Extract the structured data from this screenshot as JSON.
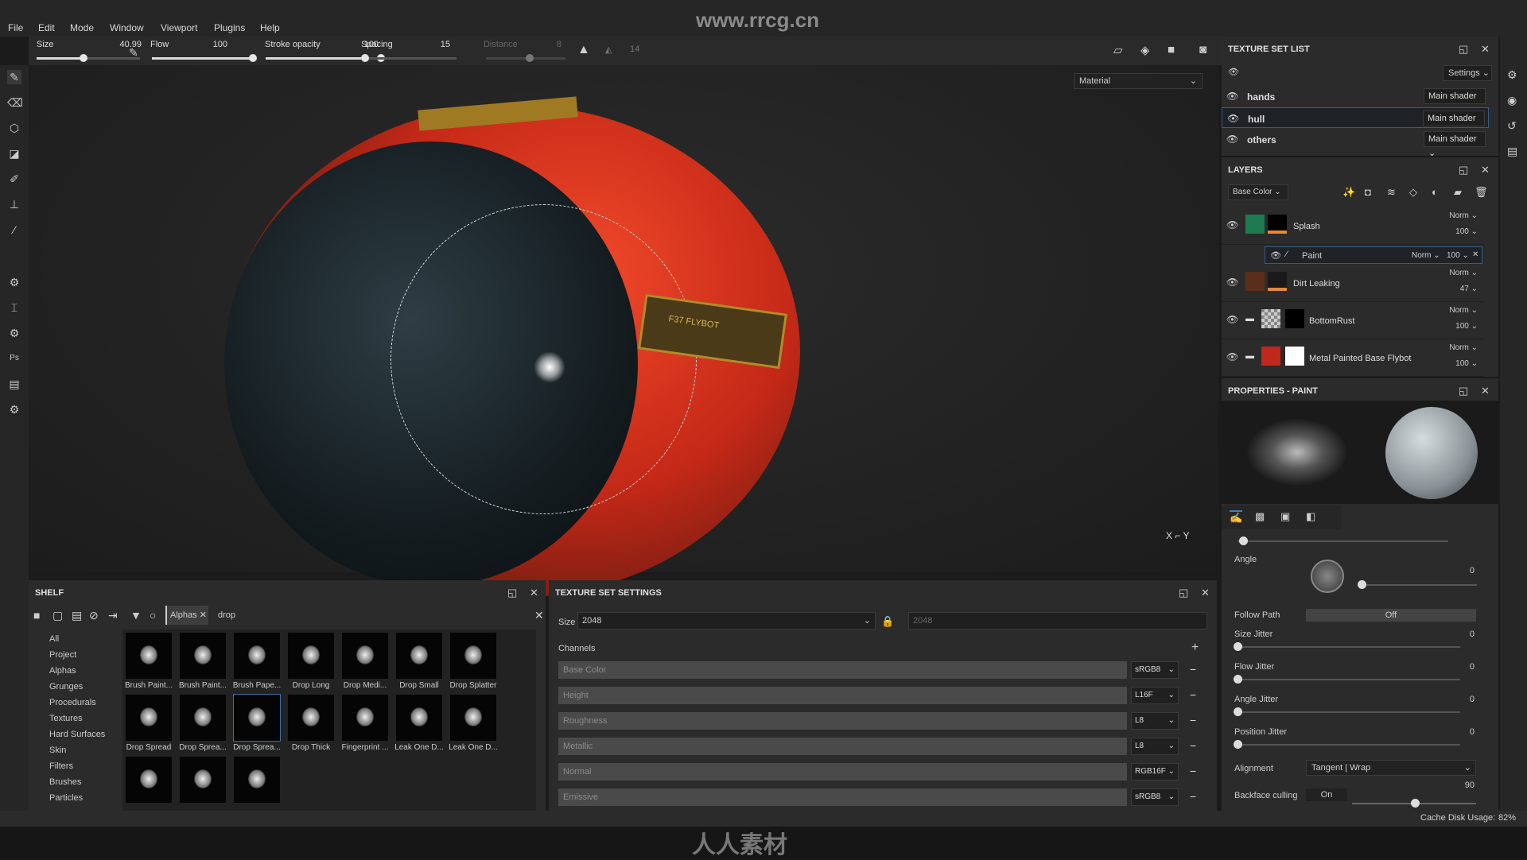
{
  "watermark": "www.rrcg.cn",
  "menu": [
    "File",
    "Edit",
    "Mode",
    "Window",
    "Viewport",
    "Plugins",
    "Help"
  ],
  "toolbar": {
    "size_label": "Size",
    "size_value": "40.99",
    "size_fraction": 0.45,
    "flow_label": "Flow",
    "flow_value": "100",
    "flow_fraction": 1.0,
    "stroke_opacity_label": "Stroke opacity",
    "stroke_opacity_value": "100",
    "stroke_fraction": 1.0,
    "spacing_label": "Spacing",
    "spacing_value": "15",
    "spacing_fraction": 0.05,
    "distance_label": "Distance",
    "distance_value": "8",
    "lazy_value": "14"
  },
  "viewport": {
    "channel_select": "Material",
    "model_label": "F37 FLYBOT"
  },
  "texture_set_list": {
    "title": "TEXTURE SET LIST",
    "settings_label": "Settings",
    "sets": [
      {
        "name": "hands",
        "shader": "Main shader"
      },
      {
        "name": "hull",
        "shader": "Main shader",
        "selected": true
      },
      {
        "name": "others",
        "shader": "Main shader"
      }
    ]
  },
  "layers": {
    "title": "LAYERS",
    "channel": "Base Color",
    "items": [
      {
        "name": "Splash",
        "blend": "Norm",
        "opacity": "100",
        "color": "#1f7a4f"
      },
      {
        "name": "Paint",
        "blend": "Norm",
        "opacity": "100",
        "sub": true
      },
      {
        "name": "Dirt Leaking",
        "blend": "Norm",
        "opacity": "47",
        "color": "#5a2e1a"
      },
      {
        "name": "BottomRust",
        "blend": "Norm",
        "opacity": "100"
      },
      {
        "name": "Metal Painted Base Flybot",
        "blend": "Norm",
        "opacity": "100",
        "color": "#c0281c"
      }
    ]
  },
  "properties": {
    "title": "PROPERTIES - PAINT",
    "angle_label": "Angle",
    "angle_value": "0",
    "follow_path_label": "Follow Path",
    "follow_path_value": "Off",
    "size_jitter_label": "Size Jitter",
    "size_jitter_value": "0",
    "flow_jitter_label": "Flow Jitter",
    "flow_jitter_value": "0",
    "angle_jitter_label": "Angle Jitter",
    "angle_jitter_value": "0",
    "position_jitter_label": "Position Jitter",
    "position_jitter_value": "0",
    "alignment_label": "Alignment",
    "alignment_value": "Tangent | Wrap",
    "backface_label": "Backface culling",
    "backface_value": "On",
    "backface_angle": "90"
  },
  "shelf": {
    "title": "SHELF",
    "filter_tag": "Alphas",
    "search": "drop",
    "categories": [
      "All",
      "Project",
      "Alphas",
      "Grunges",
      "Procedurals",
      "Textures",
      "Hard Surfaces",
      "Skin",
      "Filters",
      "Brushes",
      "Particles"
    ],
    "items": [
      "Brush Paint...",
      "Brush Paint...",
      "Brush Pape...",
      "Drop Long",
      "Drop Medi...",
      "Drop Small",
      "Drop Splatter",
      "Drop Spread",
      "Drop Sprea...",
      "Drop Sprea...",
      "Drop Thick",
      "Fingerprint ...",
      "Leak One D...",
      "Leak One D...",
      "",
      "",
      ""
    ]
  },
  "texture_set_settings": {
    "title": "TEXTURE SET SETTINGS",
    "size_label": "Size",
    "size_value": "2048",
    "size_value2": "2048",
    "channels_label": "Channels",
    "channels": [
      {
        "name": "Base Color",
        "format": "sRGB8"
      },
      {
        "name": "Height",
        "format": "L16F"
      },
      {
        "name": "Roughness",
        "format": "L8"
      },
      {
        "name": "Metallic",
        "format": "L8"
      },
      {
        "name": "Normal",
        "format": "RGB16F"
      },
      {
        "name": "Emissive",
        "format": "sRGB8"
      }
    ]
  },
  "status": {
    "cache_label": "Cache Disk Usage:",
    "cache_value": "82%"
  },
  "footer_logo": "人人素材"
}
